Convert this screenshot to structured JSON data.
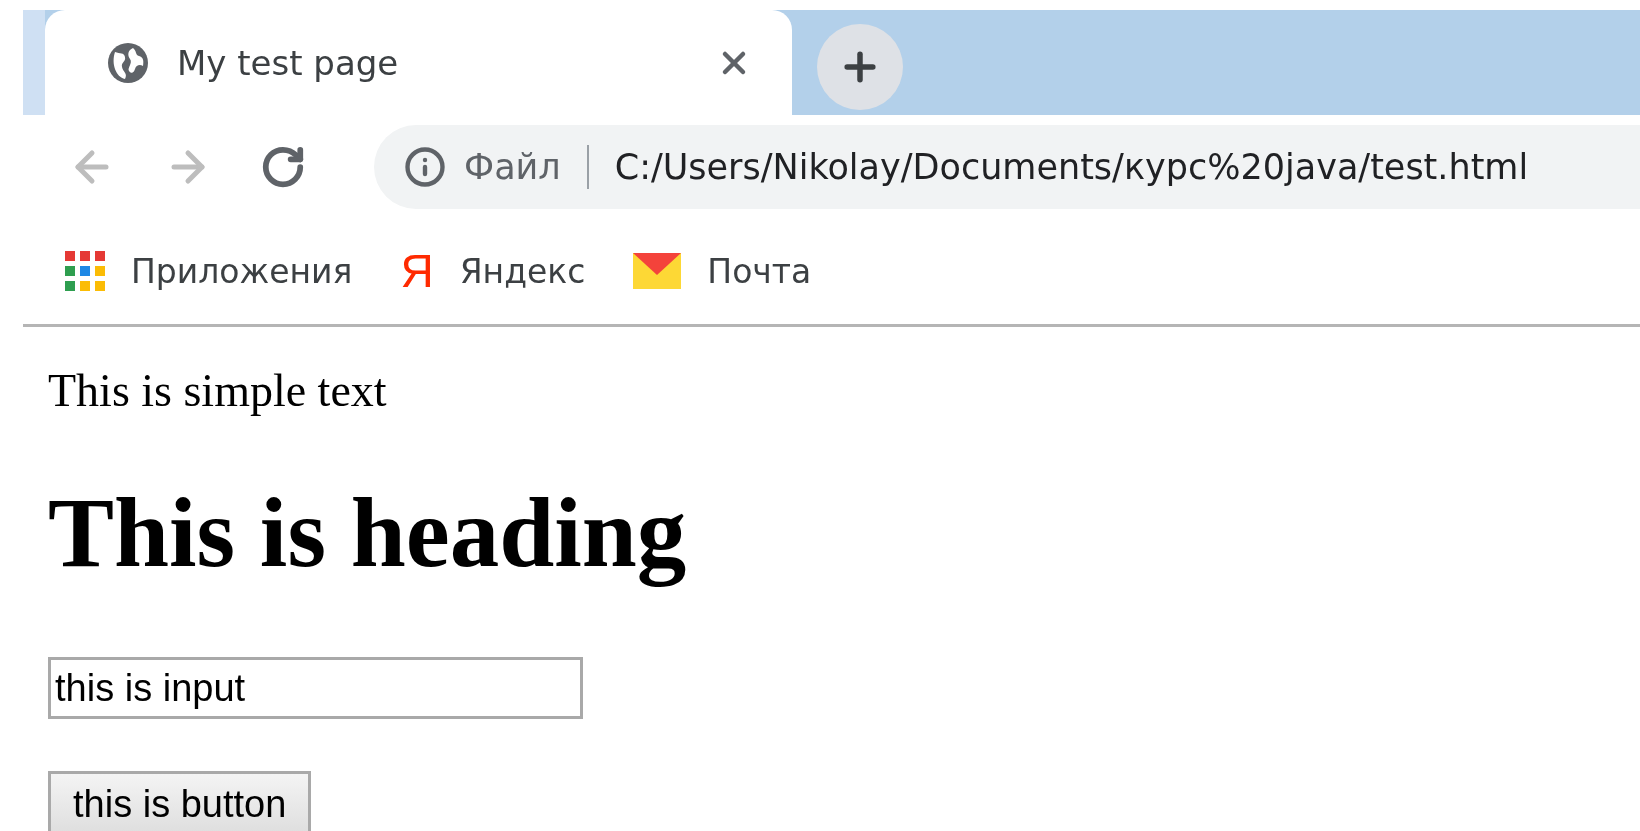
{
  "tab": {
    "title": "My test page"
  },
  "address": {
    "scheme_label": "Файл",
    "url": "C:/Users/Nikolay/Documents/курс%20java/test.html"
  },
  "bookmarks": [
    {
      "kind": "apps",
      "label": "Приложения"
    },
    {
      "kind": "yandex",
      "glyph": "Я",
      "label": "Яндекс"
    },
    {
      "kind": "mail",
      "label": "Почта"
    }
  ],
  "page": {
    "text": "This is simple text",
    "heading": "This is heading",
    "input_value": "this is input",
    "button": "this is button"
  }
}
